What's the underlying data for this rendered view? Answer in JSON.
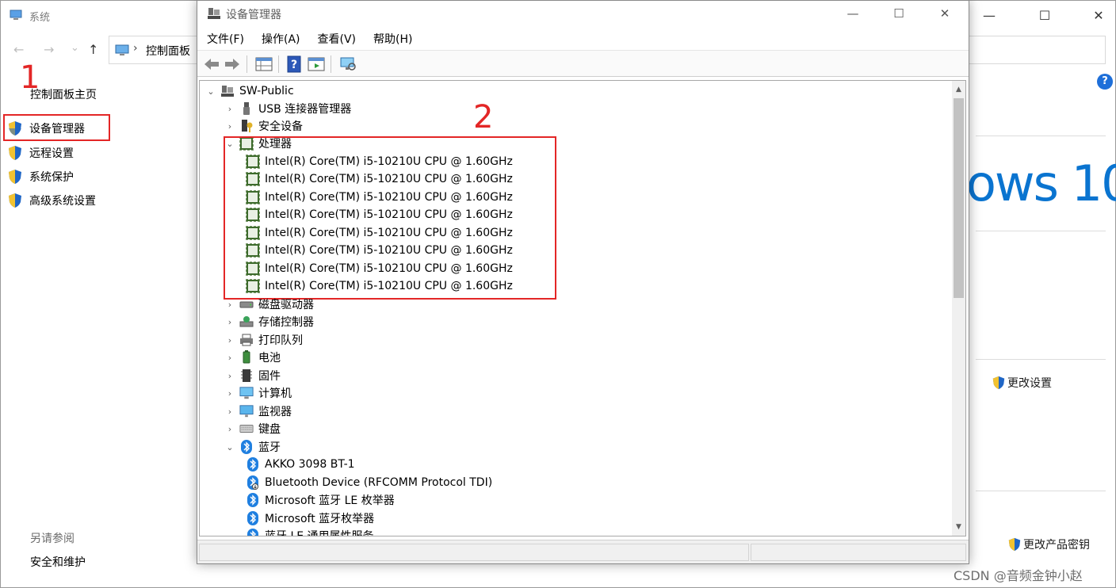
{
  "system_window": {
    "title": "系统",
    "caption_min": "—",
    "caption_max": "☐",
    "caption_close": "✕",
    "nav_back": "←",
    "nav_forward": "→",
    "nav_recent": "⌄",
    "nav_up": "↑",
    "address_text": "控制面板",
    "help": "?",
    "left_pane": {
      "home": "控制面板主页",
      "items": [
        {
          "label": "设备管理器",
          "icon": "uac-shield-icon"
        },
        {
          "label": "远程设置",
          "icon": "uac-shield-icon"
        },
        {
          "label": "系统保护",
          "icon": "uac-shield-icon"
        },
        {
          "label": "高级系统设置",
          "icon": "uac-shield-icon"
        }
      ],
      "see_also": "另请参阅",
      "see_also_link": "安全和维护"
    },
    "brand_fragment": "ows 10",
    "change_settings": "更改设置",
    "change_product_key": "更改产品密钥"
  },
  "annotations": {
    "marker_1": "1",
    "marker_2": "2",
    "highlight_color": "#e32626"
  },
  "device_manager": {
    "title": "设备管理器",
    "caption_min": "—",
    "caption_max": "☐",
    "caption_close": "✕",
    "menu": [
      "文件(F)",
      "操作(A)",
      "查看(V)",
      "帮助(H)"
    ],
    "toolbar_icons": [
      "back-arrow-icon",
      "forward-arrow-icon",
      "properties-grid-icon",
      "help-book-icon",
      "update-driver-icon",
      "scan-monitor-icon"
    ],
    "tree": {
      "root": "SW-Public",
      "nodes": [
        {
          "label": "USB 连接器管理器",
          "icon": "usb-icon",
          "expanded": false
        },
        {
          "label": "安全设备",
          "icon": "security-key-icon",
          "expanded": false
        },
        {
          "label": "处理器",
          "icon": "cpu-icon",
          "expanded": true,
          "children": [
            "Intel(R) Core(TM) i5-10210U CPU @ 1.60GHz",
            "Intel(R) Core(TM) i5-10210U CPU @ 1.60GHz",
            "Intel(R) Core(TM) i5-10210U CPU @ 1.60GHz",
            "Intel(R) Core(TM) i5-10210U CPU @ 1.60GHz",
            "Intel(R) Core(TM) i5-10210U CPU @ 1.60GHz",
            "Intel(R) Core(TM) i5-10210U CPU @ 1.60GHz",
            "Intel(R) Core(TM) i5-10210U CPU @ 1.60GHz",
            "Intel(R) Core(TM) i5-10210U CPU @ 1.60GHz"
          ]
        },
        {
          "label": "磁盘驱动器",
          "icon": "disk-drive-icon",
          "expanded": false
        },
        {
          "label": "存储控制器",
          "icon": "storage-controller-icon",
          "expanded": false
        },
        {
          "label": "打印队列",
          "icon": "printer-icon",
          "expanded": false
        },
        {
          "label": "电池",
          "icon": "battery-icon",
          "expanded": false
        },
        {
          "label": "固件",
          "icon": "firmware-chip-icon",
          "expanded": false
        },
        {
          "label": "计算机",
          "icon": "computer-icon",
          "expanded": false
        },
        {
          "label": "监视器",
          "icon": "monitor-icon",
          "expanded": false
        },
        {
          "label": "键盘",
          "icon": "keyboard-icon",
          "expanded": false
        },
        {
          "label": "蓝牙",
          "icon": "bluetooth-icon",
          "expanded": true,
          "children": [
            "AKKO 3098 BT-1",
            "Bluetooth Device (RFCOMM Protocol TDI)",
            "Microsoft 蓝牙 LE 枚举器",
            "Microsoft 蓝牙枚举器",
            "蓝牙 LE 通用属性服务"
          ]
        }
      ]
    }
  },
  "watermark": "CSDN @音频金钟小赵"
}
